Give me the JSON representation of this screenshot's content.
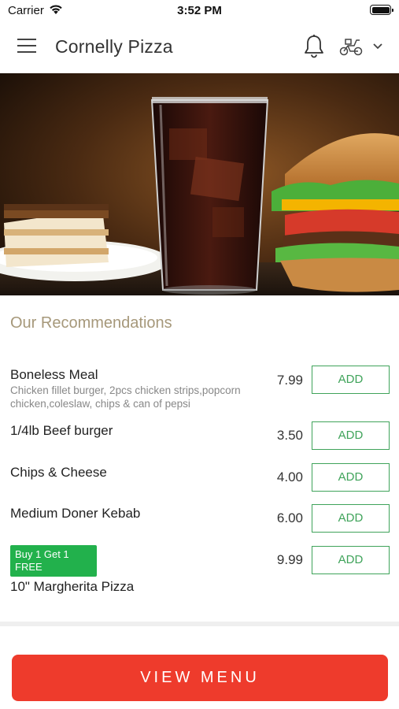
{
  "status_bar": {
    "carrier": "Carrier",
    "time": "3:52 PM"
  },
  "header": {
    "title": "Cornelly Pizza",
    "icons": [
      "menu-icon",
      "bell-icon",
      "scooter-icon",
      "chevron-down-icon"
    ]
  },
  "recommendations": {
    "title": "Our Recommendations",
    "items": [
      {
        "name": "Boneless Meal",
        "description": "Chicken fillet burger, 2pcs chicken strips,popcorn chicken,coleslaw, chips & can of pepsi",
        "price": "7.99",
        "add_label": "ADD"
      },
      {
        "name": "1/4lb Beef burger",
        "price": "3.50",
        "add_label": "ADD"
      },
      {
        "name": "Chips & Cheese",
        "price": "4.00",
        "add_label": "ADD"
      },
      {
        "name": "Medium Doner Kebab",
        "price": "6.00",
        "add_label": "ADD"
      },
      {
        "badge": "Buy 1 Get 1 FREE",
        "name": "10\" Margherita Pizza",
        "price": "9.99",
        "add_label": "ADD"
      }
    ]
  },
  "footer": {
    "view_menu_label": "VIEW MENU"
  },
  "colors": {
    "accent_green": "#3fa35a",
    "badge_green": "#22b14c",
    "cta_red": "#ee3b2c",
    "section_title": "#a6987a"
  }
}
